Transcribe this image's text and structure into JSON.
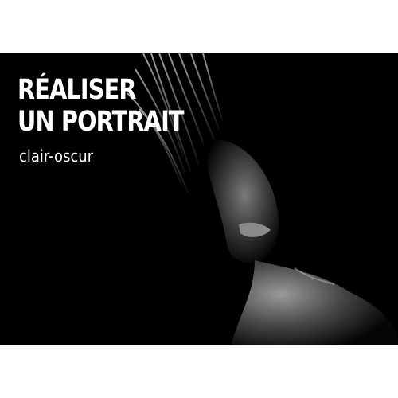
{
  "title": {
    "line1": "RÉALISER",
    "line2": "UN PORTRAIT"
  },
  "subtitle": "clair-oscur",
  "colors": {
    "background": "#000000",
    "border": "#ffffff",
    "text": "#ffffff"
  }
}
